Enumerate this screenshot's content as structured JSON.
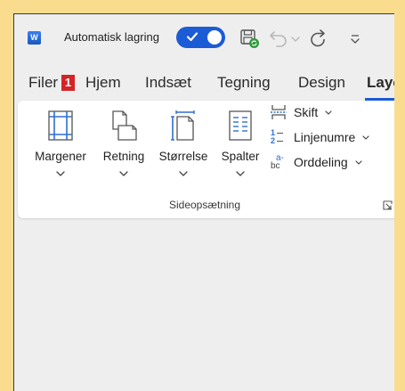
{
  "titlebar": {
    "app_icon_letter": "W",
    "autosave_label": "Automatisk lagring",
    "autosave_state": "on",
    "icons": [
      "save-sync-icon",
      "undo-icon",
      "undo-dropdown-icon",
      "redo-icon",
      "customize-toolbar-icon"
    ]
  },
  "tabs": {
    "file": "Filer",
    "file_badge": "1",
    "home": "Hjem",
    "insert": "Indsæt",
    "draw": "Tegning",
    "design": "Design",
    "layout": "Layo"
  },
  "ribbon": {
    "margins": "Margener",
    "orientation": "Retning",
    "size": "Størrelse",
    "columns": "Spalter",
    "breaks": "Skift",
    "line_numbers": "Linjenumre",
    "hyphenation": "Orddeling",
    "hyphenation_icon_top": "a-",
    "hyphenation_icon_bottom": "bc",
    "line_numbers_icon_1": "1",
    "line_numbers_icon_2": "2",
    "group_label": "Sideopsætning"
  },
  "colors": {
    "background": "#f9dc8e",
    "accent": "#1c5bd6",
    "badge": "#d42426",
    "icon_blue": "#2f6fd0"
  }
}
